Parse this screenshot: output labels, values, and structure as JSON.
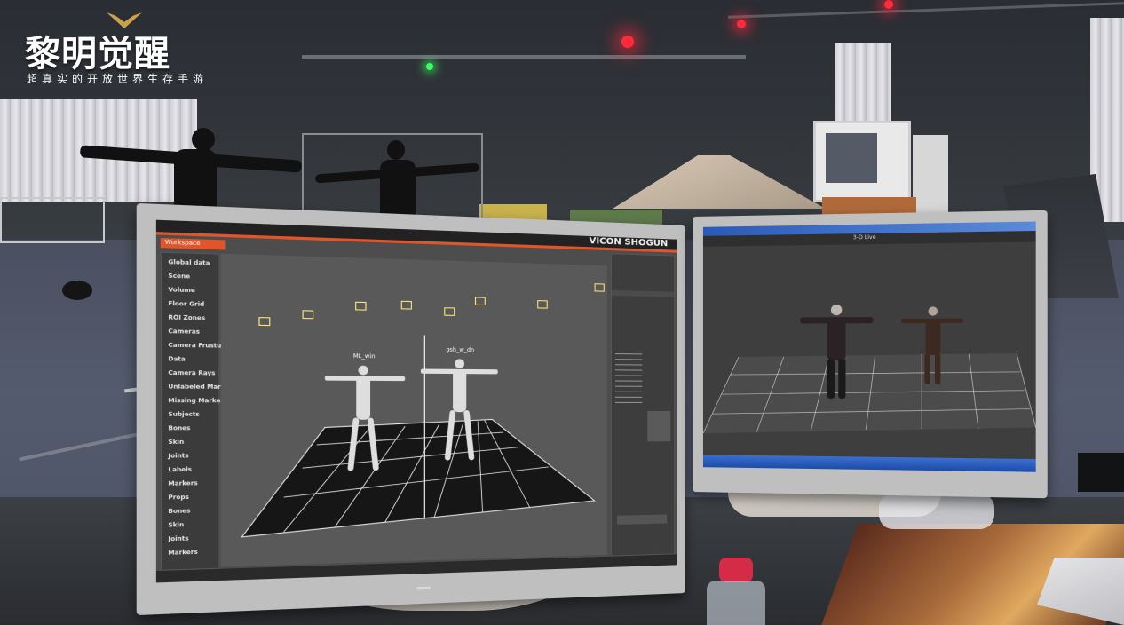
{
  "logo": {
    "title": "黎明觉醒",
    "subtitle": "超真实的开放世界生存手游"
  },
  "left_monitor": {
    "brand": "VICON SHOGUN",
    "tabs": [
      "Workspace"
    ],
    "sidebar_items": [
      "Global data",
      "Scene",
      "Volume",
      "Floor Grid",
      "ROI Zones",
      "Cameras",
      "Camera Frustum",
      "Data",
      "Camera Rays",
      "Unlabeled Markers",
      "Missing Markers",
      "Subjects",
      "Bones",
      "Skin",
      "Joints",
      "Labels",
      "Markers",
      "Props",
      "Bones",
      "Skin",
      "Joints",
      "Markers"
    ],
    "subject_labels": [
      "ML_win",
      "gsh_w_dn"
    ]
  },
  "right_monitor": {
    "view_title": "3-D Live"
  },
  "colors": {
    "accent_orange": "#e0552a",
    "grid_white": "#e8e8e8",
    "marker_yellow": "#ffe47a",
    "led_red": "#ff2a3a",
    "led_green": "#37ff60"
  }
}
